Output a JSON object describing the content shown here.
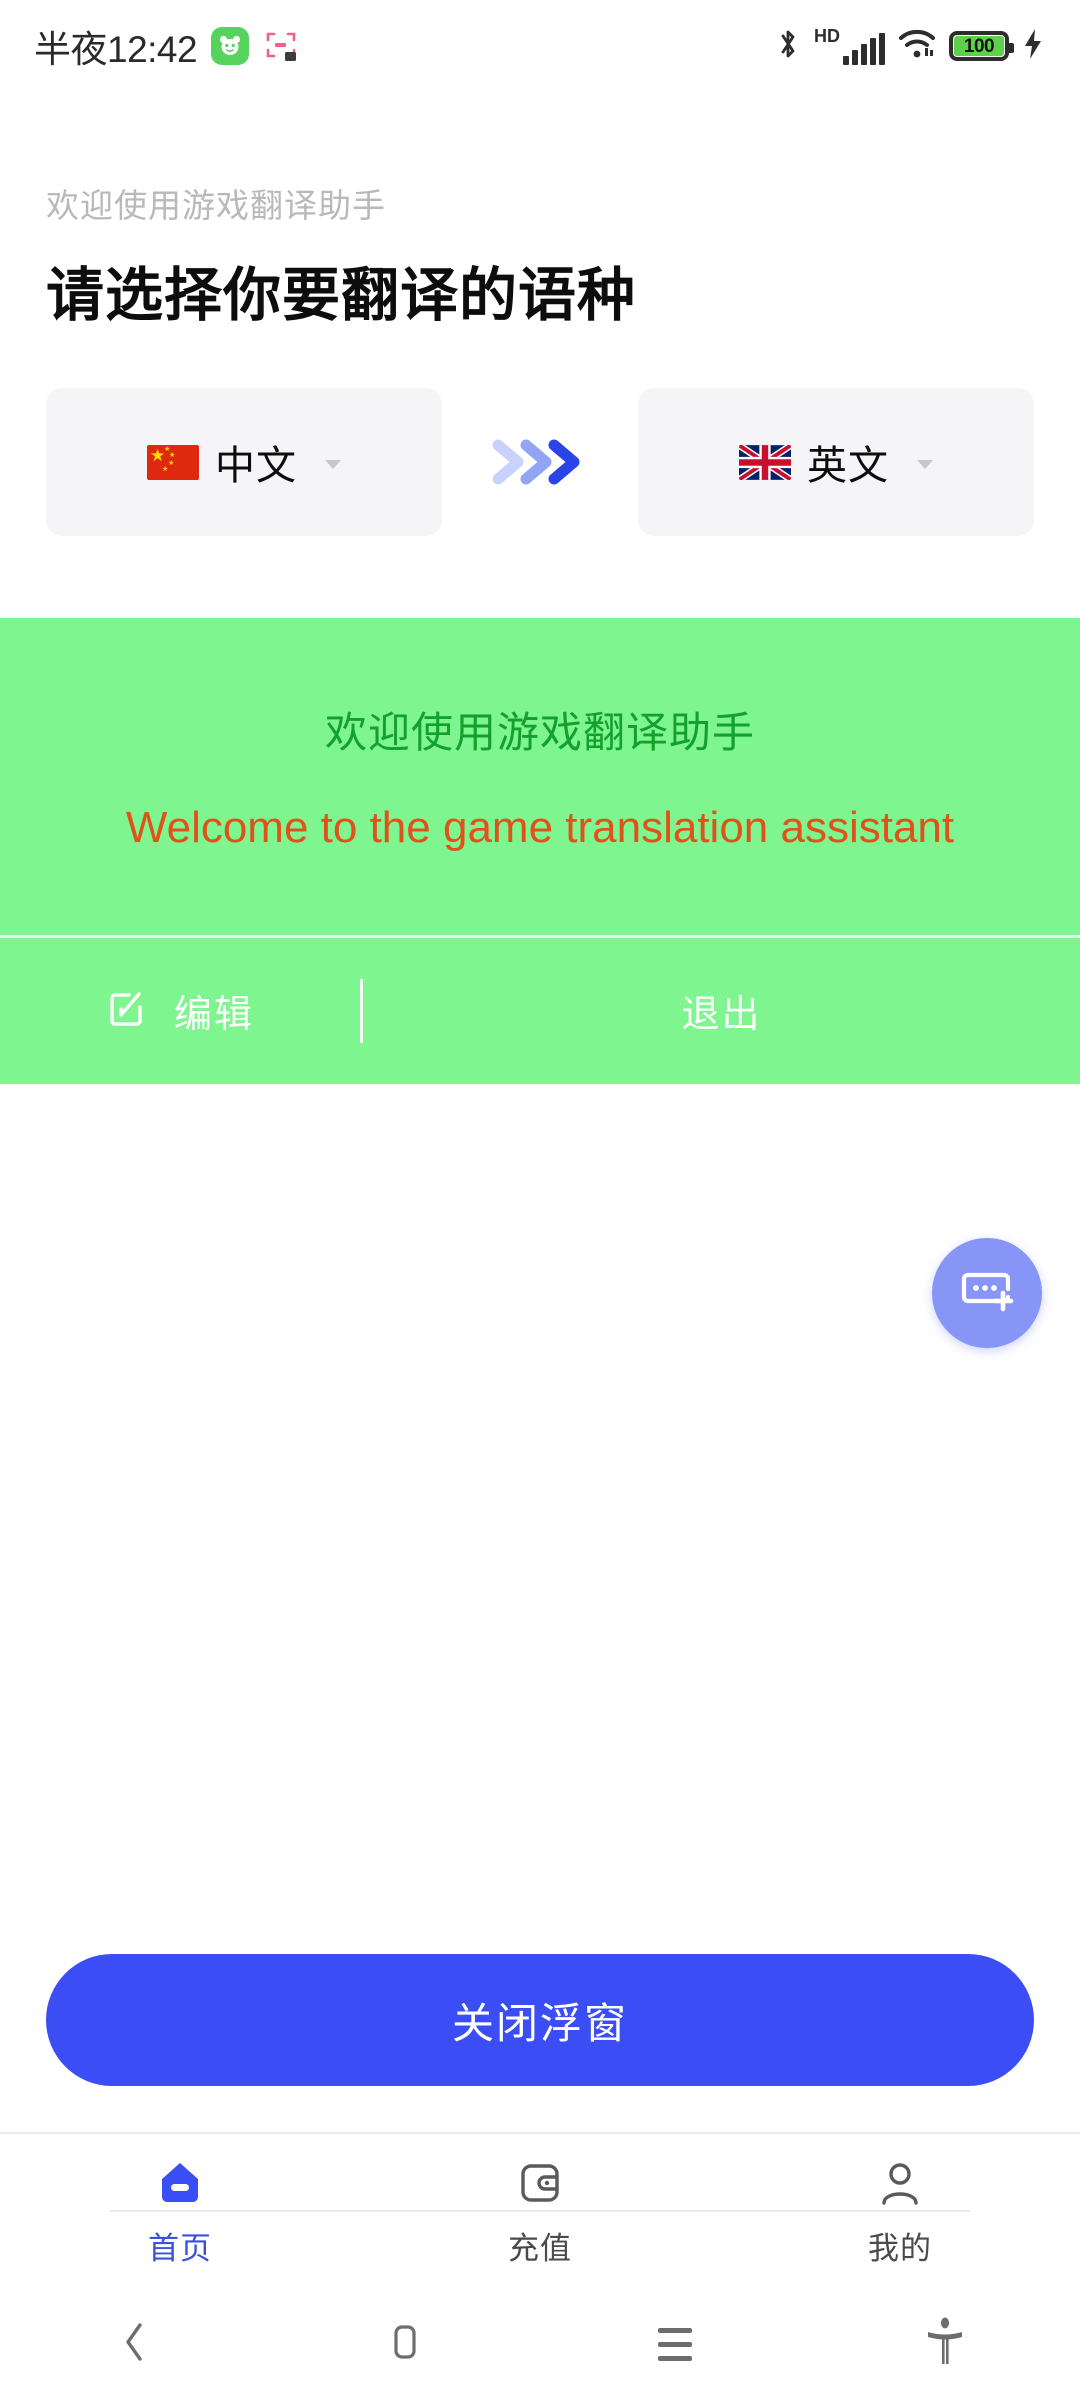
{
  "status_bar": {
    "clock": "半夜12:42",
    "app_icon": "panda-app-icon",
    "scan_icon": "scan-frame-icon",
    "bluetooth_icon": "bluetooth-icon",
    "hd_label": "HD",
    "signal_icon": "cellular-signal-icon",
    "wifi_icon": "wifi-icon",
    "battery_level": "100",
    "charging_icon": "charging-bolt-icon"
  },
  "header": {
    "subtitle": "欢迎使用游戏翻译助手",
    "title": "请选择你要翻译的语种"
  },
  "language_selector": {
    "source": {
      "label": "中文",
      "flag": "china-flag-icon",
      "caret": "chevron-down-icon"
    },
    "arrow_icon": "triple-chevron-right-icon",
    "target": {
      "label": "英文",
      "flag": "uk-flag-icon",
      "caret": "chevron-down-icon"
    }
  },
  "translation_panel": {
    "background_color": "#7ef58f",
    "source_text": "欢迎使用游戏翻译助手",
    "source_color": "#14a02d",
    "translated_text": "Welcome to the game translation assistant",
    "translated_color": "#e0521a",
    "actions": {
      "edit_label": "编辑",
      "edit_icon": "edit-pencil-square-icon",
      "exit_label": "退出"
    }
  },
  "fab": {
    "icon": "add-caption-card-icon",
    "color": "#8796f6"
  },
  "primary_button": {
    "label": "关闭浮窗",
    "color": "#3b4ef5"
  },
  "tabbar": {
    "active_color": "#3b52d8",
    "items": [
      {
        "label": "首页",
        "icon": "home-icon",
        "active": true
      },
      {
        "label": "充值",
        "icon": "wallet-icon",
        "active": false
      },
      {
        "label": "我的",
        "icon": "person-icon",
        "active": false
      }
    ]
  },
  "navbar": {
    "back_icon": "back-chevron-icon",
    "home_icon": "home-square-icon",
    "recents_icon": "recents-lines-icon",
    "accessibility_icon": "accessibility-person-icon"
  }
}
